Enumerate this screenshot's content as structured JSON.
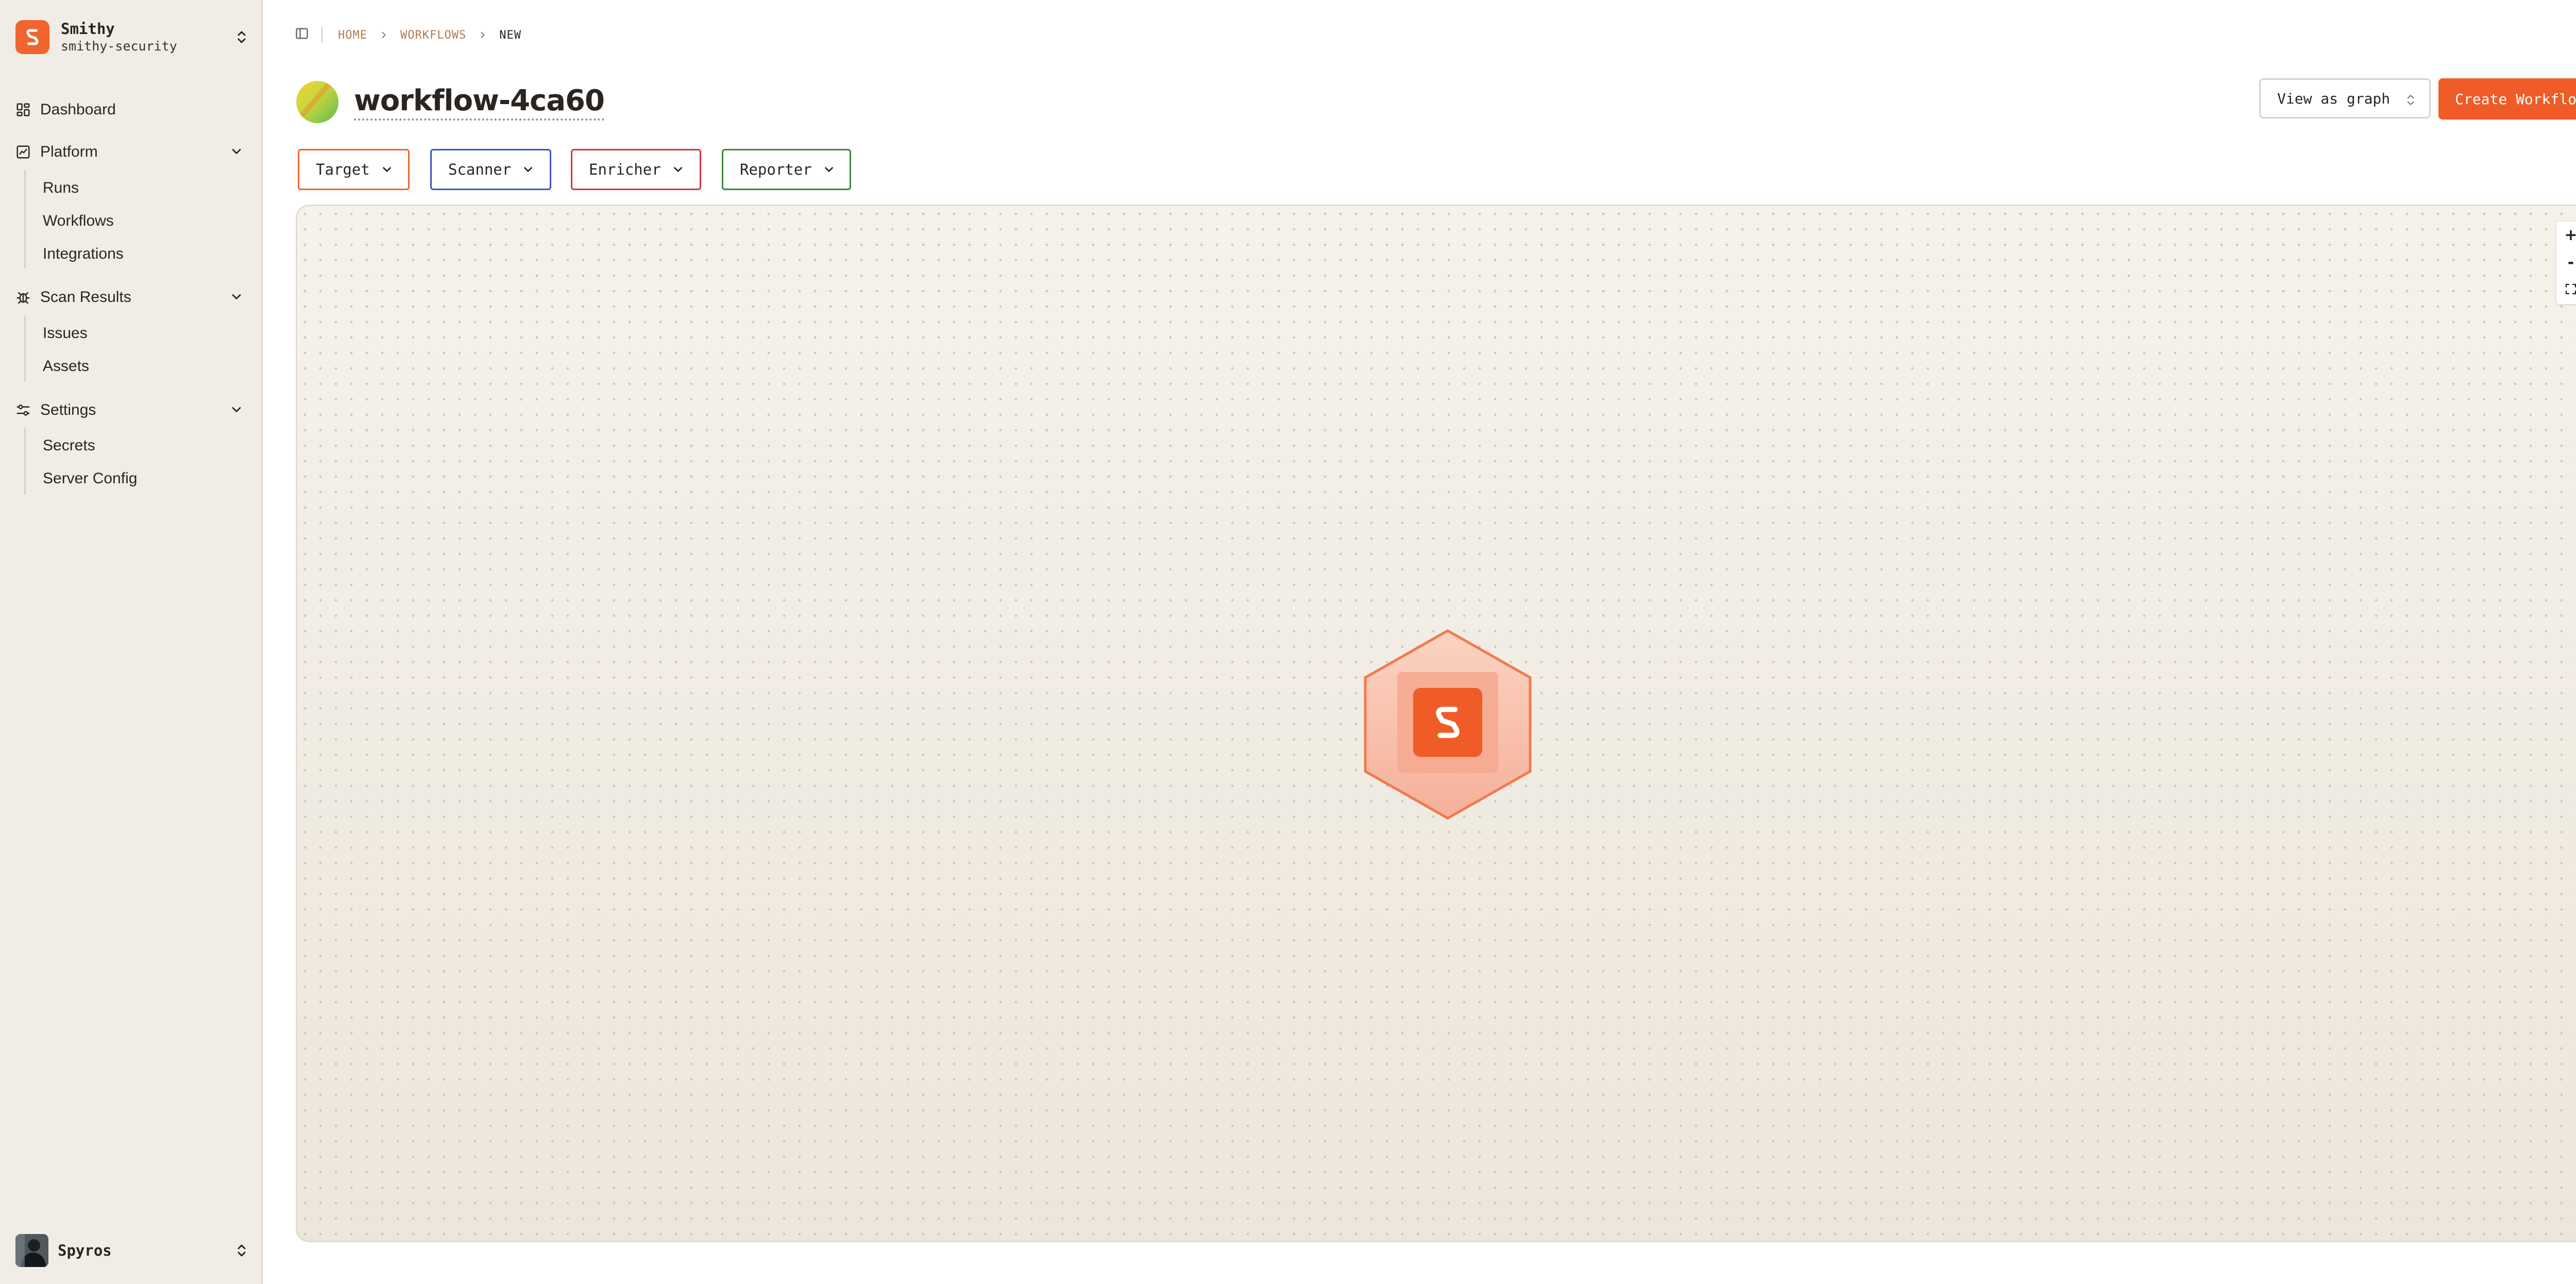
{
  "org": {
    "name": "Smithy",
    "subtitle": "smithy-security"
  },
  "nav": {
    "dashboard": "Dashboard",
    "platform": {
      "label": "Platform",
      "items": [
        "Runs",
        "Workflows",
        "Integrations"
      ]
    },
    "scan_results": {
      "label": "Scan Results",
      "items": [
        "Issues",
        "Assets"
      ]
    },
    "settings": {
      "label": "Settings",
      "items": [
        "Secrets",
        "Server Config"
      ]
    }
  },
  "user": {
    "name": "Spyros"
  },
  "breadcrumb": [
    "HOME",
    "WORKFLOWS",
    "NEW"
  ],
  "workflow": {
    "name": "workflow-4ca60"
  },
  "view_select": {
    "value": "View as graph"
  },
  "create_button": "Create Workflow",
  "categories": [
    {
      "label": "Target",
      "color": "#f0652f"
    },
    {
      "label": "Scanner",
      "color": "#3b55c9"
    },
    {
      "label": "Enricher",
      "color": "#d9323f"
    },
    {
      "label": "Reporter",
      "color": "#3a8a3f"
    }
  ],
  "zoom_controls": {
    "zoom_in": "+",
    "zoom_out": "-"
  },
  "colors": {
    "brand": "#f0652f",
    "sidebar_bg": "#f1ede6",
    "canvas_bg": "#f3efe7"
  },
  "icons": [
    "smithy-logo-icon",
    "chevron-up-down-icon",
    "sidebar-toggle-icon",
    "chevron-right-icon",
    "dashboard-icon",
    "platform-icon",
    "bug-icon",
    "settings-sliders-icon",
    "chevron-down-icon",
    "fit-view-icon"
  ]
}
